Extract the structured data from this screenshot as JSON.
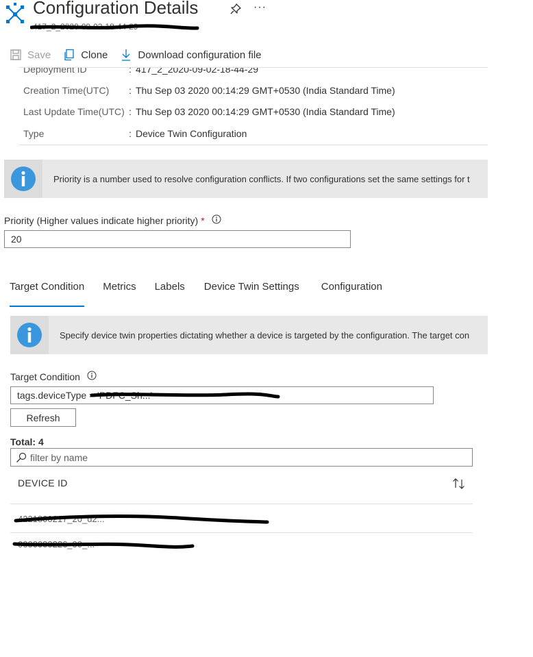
{
  "header": {
    "title": "Configuration Details",
    "subtitle": "417_2_2020-09-02-18-44-29",
    "more_label": "···"
  },
  "toolbar": {
    "save_label": "Save",
    "clone_label": "Clone",
    "download_label": "Download configuration file"
  },
  "properties": [
    {
      "label": "Deployment ID",
      "value": "417_2_2020-09-02-18-44-29"
    },
    {
      "label": "Creation Time(UTC)",
      "value": "Thu Sep 03 2020 00:14:29 GMT+0530 (India Standard Time)"
    },
    {
      "label": "Last Update Time(UTC)",
      "value": "Thu Sep 03 2020 00:14:29 GMT+0530 (India Standard Time)"
    },
    {
      "label": "Type",
      "value": "Device Twin Configuration"
    }
  ],
  "priority_banner": {
    "text": "Priority is a number used to resolve configuration conflicts. If two configurations set the same settings for t"
  },
  "priority": {
    "label": "Priority (Higher values indicate higher priority)",
    "required_mark": "*",
    "value": "20"
  },
  "tabs": [
    {
      "label": "Target Condition",
      "active": true
    },
    {
      "label": "Metrics",
      "active": false
    },
    {
      "label": "Labels",
      "active": false
    },
    {
      "label": "Device Twin Settings",
      "active": false
    },
    {
      "label": "Configuration",
      "active": false
    }
  ],
  "target_banner": {
    "text": "Specify device twin properties dictating whether a device is targeted by the configuration.  The target con"
  },
  "target_condition": {
    "label": "Target Condition",
    "value": "tags.deviceType = 'PDFC_Sh...'"
  },
  "refresh_label": "Refresh",
  "total_label": "Total: 4",
  "filter": {
    "placeholder": "filter by name"
  },
  "device_table": {
    "column_header": "DEVICE ID",
    "rows": [
      "4221800217_20_d2...",
      "0000000226_00_..."
    ]
  },
  "colors": {
    "accent": "#0078d4",
    "info_icon": "#3a96dd",
    "required": "#a4262c"
  }
}
